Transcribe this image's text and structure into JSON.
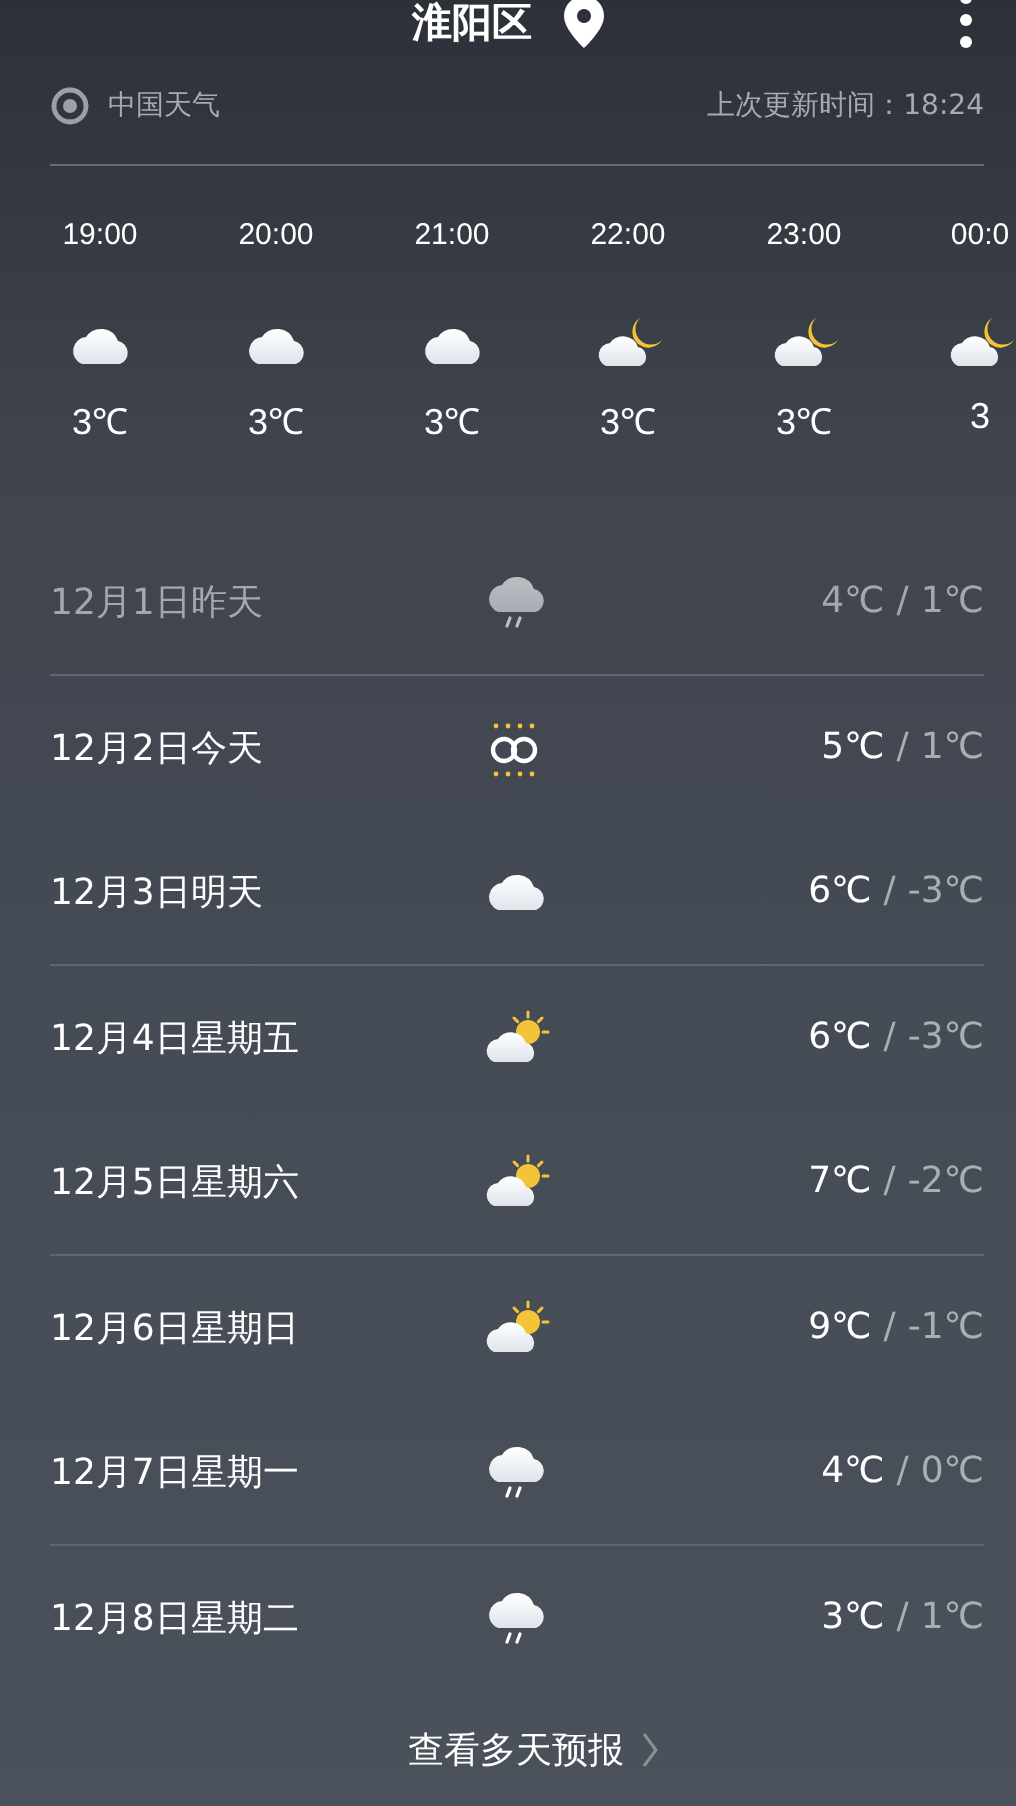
{
  "header": {
    "title": "淮阳区"
  },
  "source": {
    "name": "中国天气",
    "updated": "上次更新时间：18:24"
  },
  "hourly": [
    {
      "time": "19:00",
      "kind": "cloudy",
      "temp": "3℃"
    },
    {
      "time": "20:00",
      "kind": "cloudy",
      "temp": "3℃"
    },
    {
      "time": "21:00",
      "kind": "cloudy",
      "temp": "3℃"
    },
    {
      "time": "22:00",
      "kind": "night",
      "temp": "3℃"
    },
    {
      "time": "23:00",
      "kind": "night",
      "temp": "3℃"
    },
    {
      "time": "00:0",
      "kind": "night",
      "temp": "3"
    }
  ],
  "daily": [
    {
      "day": "12月1日昨天",
      "kind": "rain",
      "high": "4℃",
      "separator": "/",
      "low": "1℃",
      "past": true
    },
    {
      "day": "12月2日今天",
      "kind": "haze",
      "high": "5℃",
      "separator": "/",
      "low": "1℃",
      "past": false
    },
    {
      "day": "12月3日明天",
      "kind": "cloudy",
      "high": "6℃",
      "separator": "/",
      "low": "-3℃",
      "past": false
    },
    {
      "day": "12月4日星期五",
      "kind": "sunny",
      "high": "6℃",
      "separator": "/",
      "low": "-3℃",
      "past": false
    },
    {
      "day": "12月5日星期六",
      "kind": "sunny",
      "high": "7℃",
      "separator": "/",
      "low": "-2℃",
      "past": false
    },
    {
      "day": "12月6日星期日",
      "kind": "sunny",
      "high": "9℃",
      "separator": "/",
      "low": "-1℃",
      "past": false
    },
    {
      "day": "12月7日星期一",
      "kind": "rain",
      "high": "4℃",
      "separator": "/",
      "low": "0℃",
      "past": false
    },
    {
      "day": "12月8日星期二",
      "kind": "rain",
      "high": "3℃",
      "separator": "/",
      "low": "1℃",
      "past": false
    }
  ],
  "footer": {
    "link": "查看多天预报"
  }
}
